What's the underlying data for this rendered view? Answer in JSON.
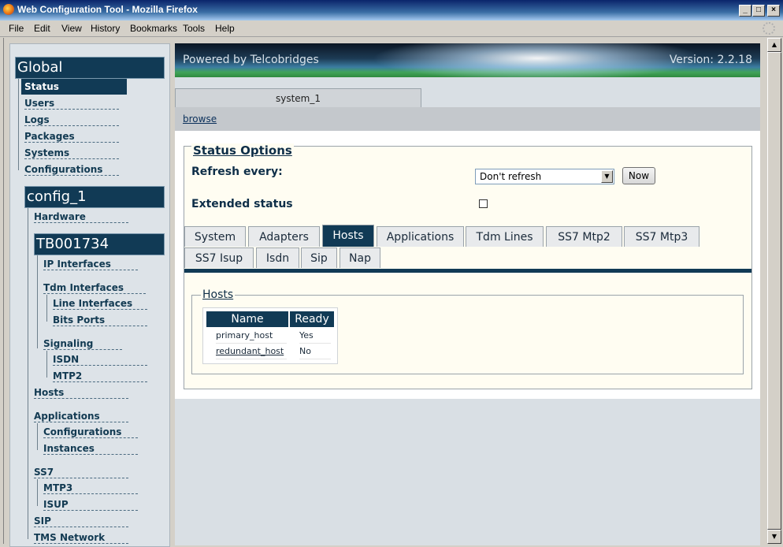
{
  "window": {
    "title": "Web Configuration Tool - Mozilla Firefox",
    "controls": [
      "_",
      "□",
      "×"
    ]
  },
  "menu": [
    "File",
    "Edit",
    "View",
    "History",
    "Bookmarks",
    "Tools",
    "Help"
  ],
  "sidebar": {
    "global_header": "Global",
    "global_items": [
      "Status",
      "Users",
      "Logs",
      "Packages",
      "Systems",
      "Configurations"
    ],
    "config_header": "config_1",
    "hardware": "Hardware",
    "device_header": "TB001734",
    "ip_interfaces": "IP Interfaces",
    "tdm_interfaces": "Tdm Interfaces",
    "line_interfaces": "Line Interfaces",
    "bits_ports": "Bits Ports",
    "signaling": "Signaling",
    "isdn": "ISDN",
    "mtp2": "MTP2",
    "hosts": "Hosts",
    "applications": "Applications",
    "app_configurations": "Configurations",
    "app_instances": "Instances",
    "ss7": "SS7",
    "mtp3": "MTP3",
    "isup": "ISUP",
    "sip": "SIP",
    "tms_network": "TMS Network"
  },
  "banner": {
    "powered": "Powered by Telcobridges",
    "version": "Version: 2.2.18"
  },
  "system_tab": "system_1",
  "browse_link": "browse",
  "status_options": {
    "legend": "Status Options",
    "refresh_label": "Refresh every:",
    "refresh_value": "Don't refresh",
    "now_button": "Now",
    "extended_label": "Extended status"
  },
  "tabs_row1": [
    "System",
    "Adapters",
    "Hosts",
    "Applications",
    "Tdm Lines",
    "SS7 Mtp2",
    "SS7 Mtp3"
  ],
  "tabs_row2": [
    "SS7 Isup",
    "Isdn",
    "Sip",
    "Nap"
  ],
  "active_tab": "Hosts",
  "hosts": {
    "legend": "Hosts",
    "columns": [
      "Name",
      "Ready"
    ],
    "rows": [
      {
        "name": "primary_host",
        "ready": "Yes"
      },
      {
        "name": "redundant_host",
        "ready": "No"
      }
    ]
  }
}
